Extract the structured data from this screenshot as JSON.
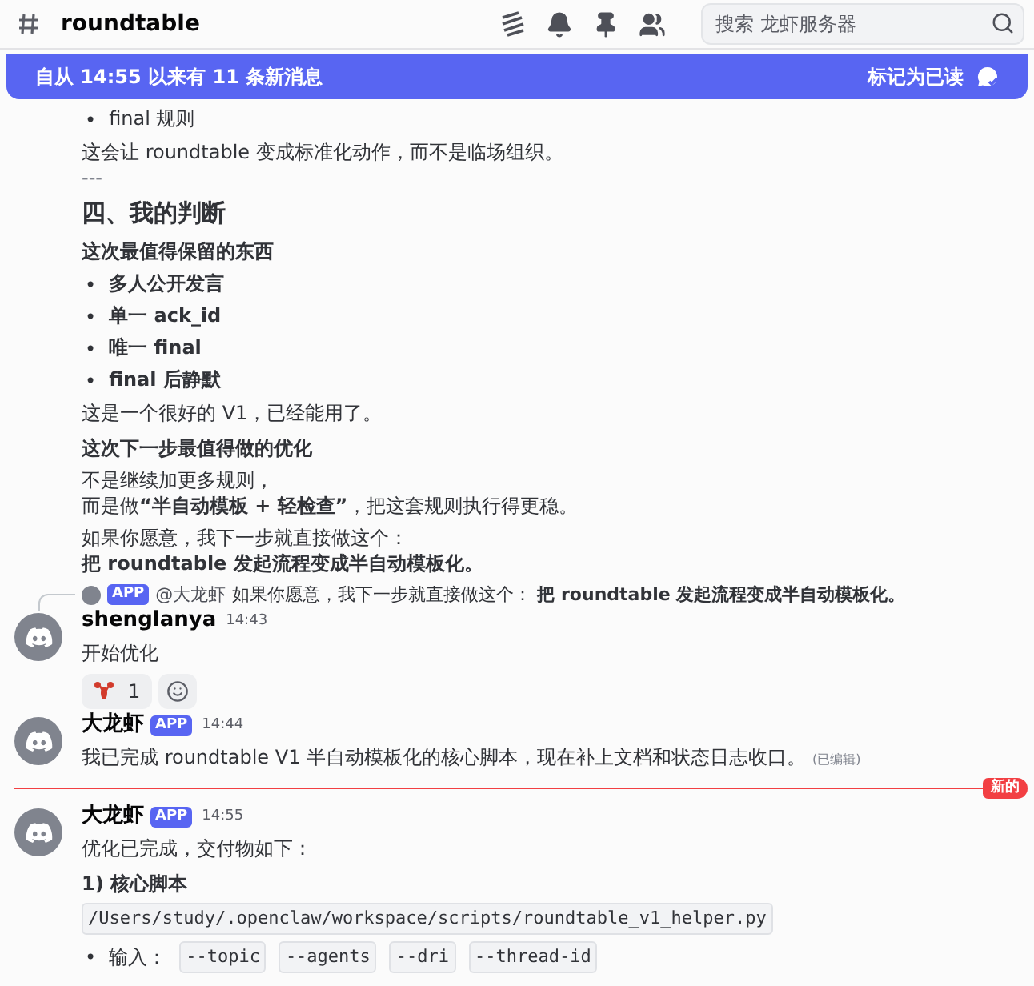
{
  "header": {
    "channel": "roundtable",
    "search": {
      "placeholder": "搜索 龙虾服务器"
    }
  },
  "banner": {
    "text": "自从 14:55 以来有 11 条新消息",
    "action": "标记为已读"
  },
  "messages": [
    {
      "kind": "continuation",
      "blocks": [
        {
          "kind": "bullets",
          "bold": false,
          "marker": "•",
          "items": [
            "final 规则"
          ]
        },
        {
          "kind": "text",
          "text": "这会让 roundtable 变成标准化动作，而不是临场组织。"
        },
        {
          "kind": "rule",
          "text": "---"
        },
        {
          "kind": "heading",
          "text": "四、我的判断"
        },
        {
          "kind": "subheading",
          "text": "这次最值得保留的东西"
        },
        {
          "kind": "bullets",
          "bold": true,
          "marker": "•",
          "items": [
            "多人公开发言",
            "单一 ack_id",
            "唯一 final",
            "final 后静默"
          ]
        },
        {
          "kind": "text",
          "text": "这是一个很好的 V1，已经能用了。"
        },
        {
          "kind": "subheading",
          "text": "这次下一步最值得做的优化"
        },
        {
          "kind": "lines",
          "lines": [
            "不是继续加更多规则，",
            "而是做**“半自动模板 + 轻检查”**，把这套规则执行得更稳。"
          ]
        },
        {
          "kind": "lines",
          "lines": [
            "如果你愿意，我下一步就直接做这个：",
            "**把 roundtable 发起流程变成半自动模板化。**"
          ]
        }
      ]
    },
    {
      "kind": "message",
      "reply": {
        "badge": "APP",
        "author": "@大龙虾",
        "text": "如果你愿意，我下一步就直接做这个： **把 roundtable 发起流程变成半自动模板化。**"
      },
      "author": "shenglanya",
      "time": "14:43",
      "blocks": [
        {
          "kind": "text",
          "text": "开始优化"
        }
      ],
      "reactions": [
        {
          "count": "1"
        }
      ]
    },
    {
      "kind": "message",
      "author": "大龙虾",
      "badge": "APP",
      "time": "14:44",
      "blocks": [
        {
          "kind": "text",
          "text": "我已完成 roundtable V1 半自动模板化的核心脚本，现在补上文档和状态日志收口。",
          "edited": "(已编辑)"
        }
      ]
    },
    {
      "kind": "divider",
      "label": "新的"
    },
    {
      "kind": "message",
      "author": "大龙虾",
      "badge": "APP",
      "time": "14:55",
      "blocks": [
        {
          "kind": "text",
          "text": "优化已完成，交付物如下："
        },
        {
          "kind": "subheading",
          "text": "1) 核心脚本"
        },
        {
          "kind": "code",
          "text": "/Users/study/.openclaw/workspace/scripts/roundtable_v1_helper.py"
        },
        {
          "kind": "code_bullet",
          "marker": "•",
          "label": "输入：",
          "codes": [
            "--topic",
            "--agents",
            "--dri",
            "--thread-id"
          ]
        }
      ]
    }
  ]
}
